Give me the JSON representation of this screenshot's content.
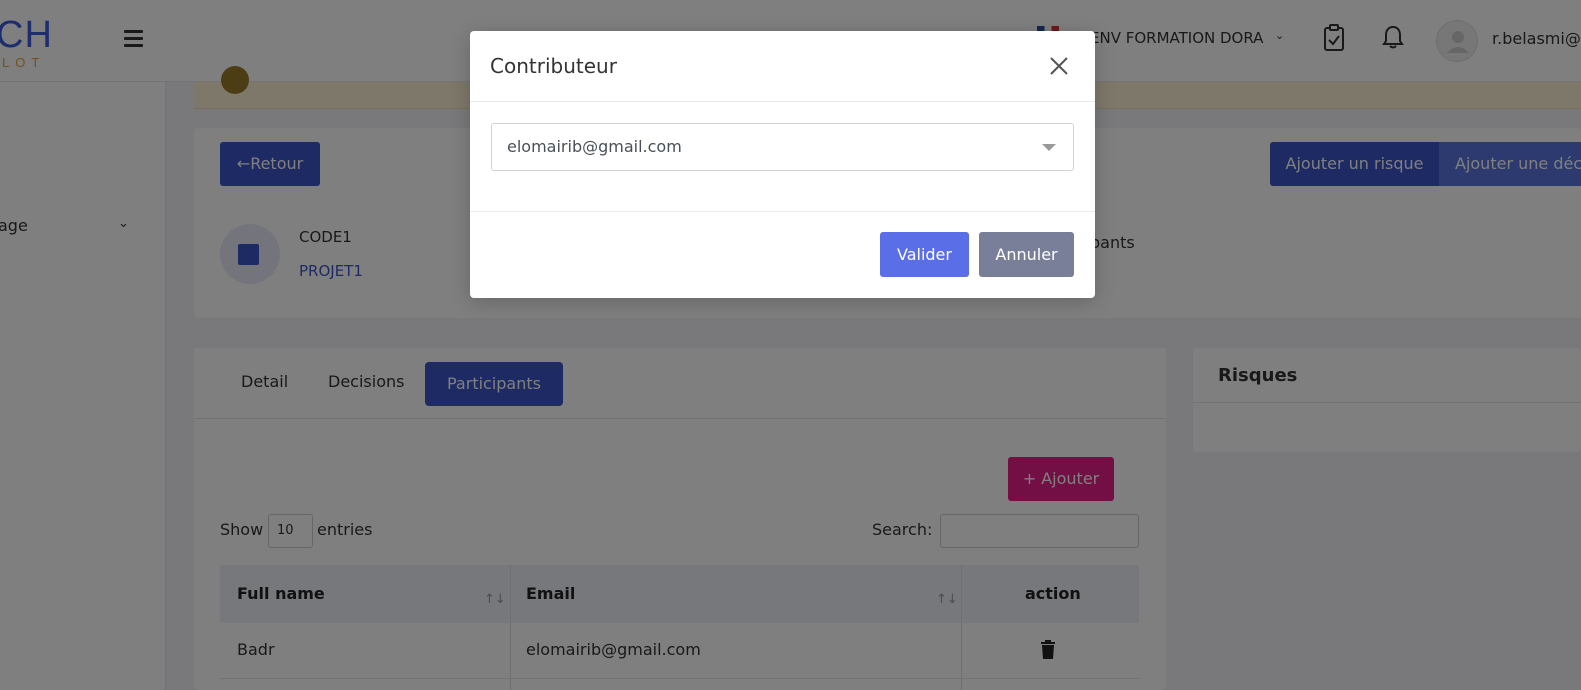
{
  "header": {
    "logo_main": "CH",
    "logo_sub": "LOT",
    "environment": "ENV FORMATION DORA",
    "username": "r.belasmi@"
  },
  "sidebar": {
    "item_label": "age"
  },
  "toolbar": {
    "back_label": "←Retour",
    "add_risk_label": "Ajouter un risque",
    "add_decision_label": "Ajouter une décision"
  },
  "project": {
    "code": "CODE1",
    "name": "PROJET1",
    "participants_caption": "pants"
  },
  "tabs": [
    {
      "label": "Detail"
    },
    {
      "label": "Decisions"
    },
    {
      "label": "Participants",
      "active": true
    }
  ],
  "participants": {
    "add_label": "+ Ajouter",
    "show_label": "Show",
    "entries_count": "10",
    "entries_label": "entries",
    "search_label": "Search:",
    "columns": [
      "Full name",
      "Email",
      "action"
    ],
    "rows": [
      {
        "full_name": "Badr",
        "email": "elomairib@gmail.com"
      }
    ]
  },
  "risques": {
    "title": "Risques"
  },
  "modal": {
    "title": "Contributeur",
    "selected_value": "elomairib@gmail.com",
    "confirm_label": "Valider",
    "cancel_label": "Annuler"
  },
  "colors": {
    "primary": "#3d54c9",
    "accent_pink": "#e91e8c",
    "confirm": "#5a6ee8",
    "cancel": "#7a7f99"
  }
}
